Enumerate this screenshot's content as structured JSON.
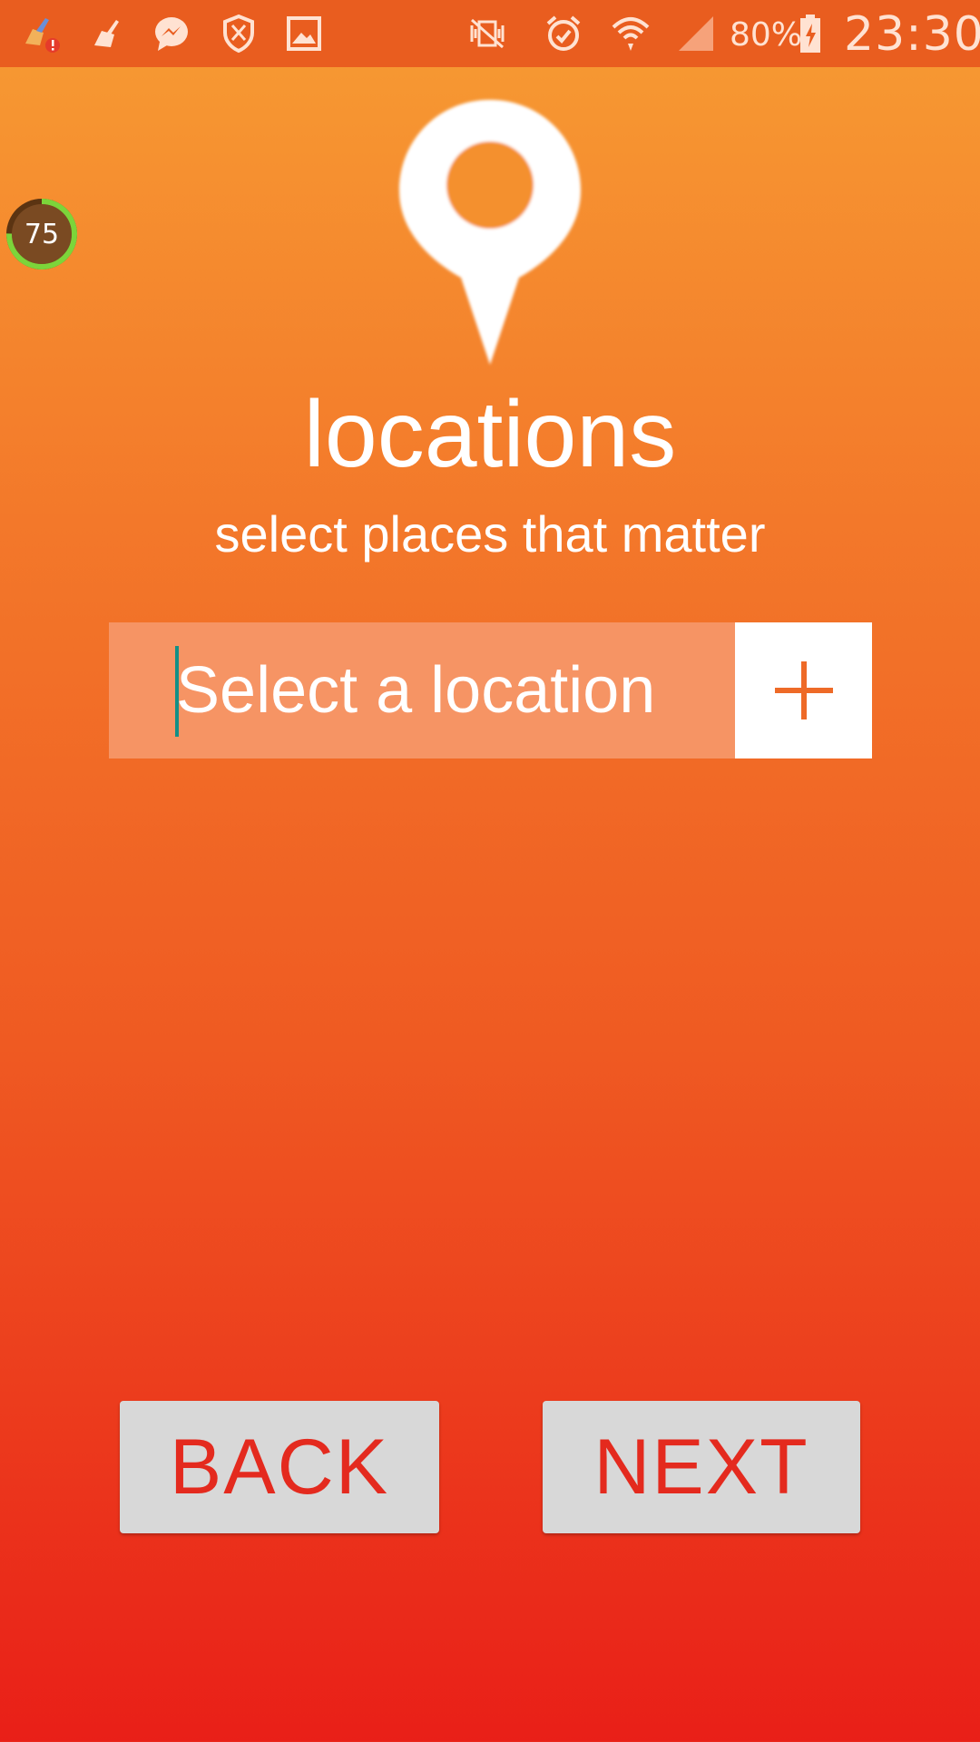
{
  "status_bar": {
    "left_icons": [
      "broom-alert-icon",
      "cleaner-icon",
      "messenger-icon",
      "shield-icon",
      "gallery-icon"
    ],
    "right_icons": [
      "vibrate-icon",
      "alarm-icon",
      "wifi-icon",
      "signal-icon",
      "battery-charging-icon"
    ],
    "battery": "80%",
    "time": "23:30"
  },
  "score_badge": {
    "value": "75",
    "ring_color": "#7CD53A",
    "fill_color": "#7A4A22"
  },
  "header": {
    "icon": "location-pin-icon",
    "title": "locations",
    "subtitle": "select places that matter"
  },
  "location_input": {
    "value": "",
    "placeholder": "Select a location",
    "add_icon": "plus-icon"
  },
  "buttons": {
    "back_label": "BACK",
    "next_label": "NEXT"
  },
  "colors": {
    "accent": "#EE6A27",
    "button_text": "#E42A1E",
    "cursor": "#138F86"
  }
}
